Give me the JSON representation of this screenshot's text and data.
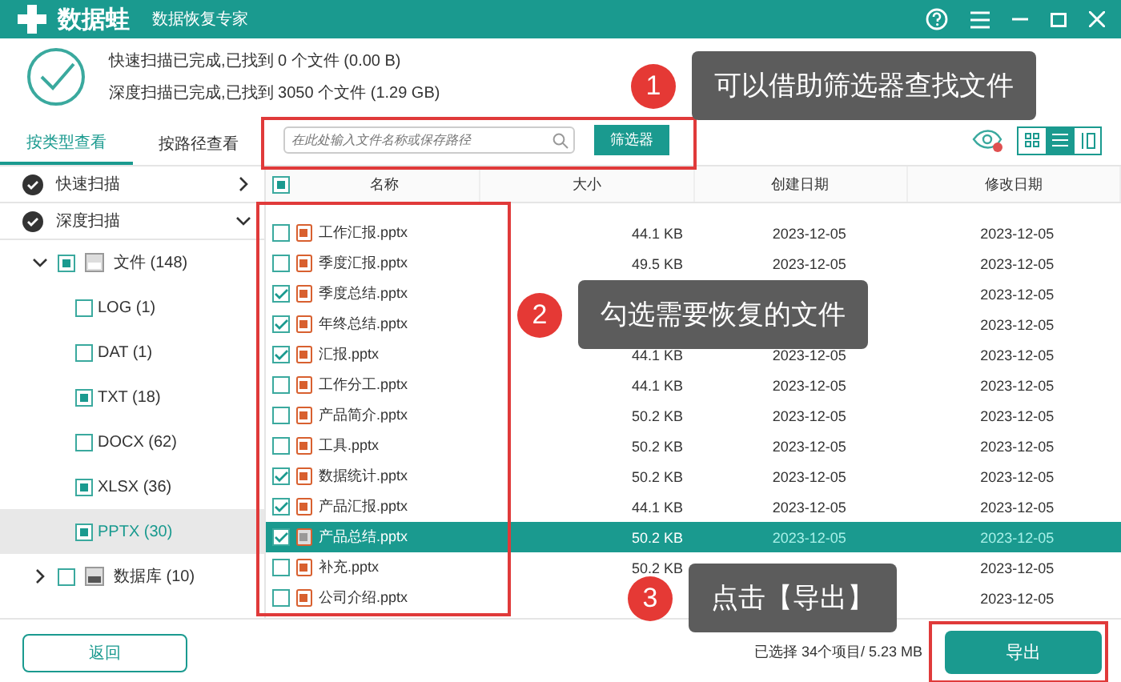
{
  "app": {
    "name": "数据蛙",
    "subtitle": "数据恢复专家"
  },
  "scan_summary": [
    "快速扫描已完成,已找到 0 个文件 (0.00  B)",
    "深度扫描已完成,已找到 3050 个文件 (1.29 GB)"
  ],
  "view_tabs": [
    {
      "label": "按类型查看",
      "selected": true
    },
    {
      "label": "按路径查看",
      "selected": false
    }
  ],
  "search": {
    "placeholder": "在此处输入文件名称或保存路径"
  },
  "filter_button": "筛选器",
  "view_modes": [
    {
      "kind": "grid",
      "selected": false
    },
    {
      "kind": "list",
      "selected": true
    },
    {
      "kind": "columns",
      "selected": false
    }
  ],
  "scans": [
    {
      "label": "快速扫描",
      "expanded": false
    },
    {
      "label": "深度扫描",
      "expanded": true
    }
  ],
  "tree": [
    {
      "label": "文件 (148)",
      "expanded": true,
      "partial": true,
      "selected": false,
      "children": [
        {
          "label": "LOG (1)",
          "partial": false,
          "selected": false
        },
        {
          "label": "DAT (1)",
          "partial": false,
          "selected": false
        },
        {
          "label": "TXT (18)",
          "partial": true,
          "selected": false
        },
        {
          "label": "DOCX (62)",
          "partial": false,
          "selected": false
        },
        {
          "label": "XLSX (36)",
          "partial": true,
          "selected": false
        },
        {
          "label": "PPTX (30)",
          "partial": true,
          "selected": true
        }
      ]
    },
    {
      "label": "数据库 (10)",
      "expanded": false,
      "partial": false,
      "selected": false
    }
  ],
  "table": {
    "columns": [
      "名称",
      "大小",
      "创建日期",
      "修改日期"
    ],
    "select_all_partial": true,
    "rows": [
      {
        "name": "工作汇报.pptx",
        "size": "44.1 KB",
        "created": "2023-12-05",
        "modified": "2023-12-05",
        "checked": false,
        "selected": false
      },
      {
        "name": "季度汇报.pptx",
        "size": "49.5 KB",
        "created": "2023-12-05",
        "modified": "2023-12-05",
        "checked": false,
        "selected": false
      },
      {
        "name": "季度总结.pptx",
        "modified": "2023-12-05",
        "checked": true,
        "selected": false
      },
      {
        "name": "年终总结.pptx",
        "modified": "2023-12-05",
        "checked": true,
        "selected": false
      },
      {
        "name": "汇报.pptx",
        "size": "44.1 KB",
        "created": "2023-12-05",
        "modified": "2023-12-05",
        "checked": true,
        "selected": false
      },
      {
        "name": "工作分工.pptx",
        "size": "44.1 KB",
        "created": "2023-12-05",
        "modified": "2023-12-05",
        "checked": false,
        "selected": false
      },
      {
        "name": "产品简介.pptx",
        "size": "50.2 KB",
        "created": "2023-12-05",
        "modified": "2023-12-05",
        "checked": false,
        "selected": false
      },
      {
        "name": "工具.pptx",
        "size": "50.2 KB",
        "created": "2023-12-05",
        "modified": "2023-12-05",
        "checked": false,
        "selected": false
      },
      {
        "name": "数据统计.pptx",
        "size": "50.2 KB",
        "created": "2023-12-05",
        "modified": "2023-12-05",
        "checked": true,
        "selected": false
      },
      {
        "name": "产品汇报.pptx",
        "size": "44.1 KB",
        "created": "2023-12-05",
        "modified": "2023-12-05",
        "checked": true,
        "selected": false
      },
      {
        "name": "产品总结.pptx",
        "size": "50.2 KB",
        "created": "2023-12-05",
        "modified": "2023-12-05",
        "checked": true,
        "selected": true
      },
      {
        "name": "补充.pptx",
        "size": "50.2 KB",
        "modified": "2023-12-05",
        "checked": false,
        "selected": false
      },
      {
        "name": "公司介绍.pptx",
        "modified": "2023-12-05",
        "checked": false,
        "selected": false
      }
    ]
  },
  "footer": {
    "back_button": "返回",
    "selection": "已选择 34个项目/ 5.23 MB",
    "export_button": "导出"
  },
  "callouts": [
    {
      "number": "1",
      "text": "可以借助筛选器查找文件"
    },
    {
      "number": "2",
      "text": "勾选需要恢复的文件"
    },
    {
      "number": "3",
      "text": "点击【导出】"
    }
  ]
}
